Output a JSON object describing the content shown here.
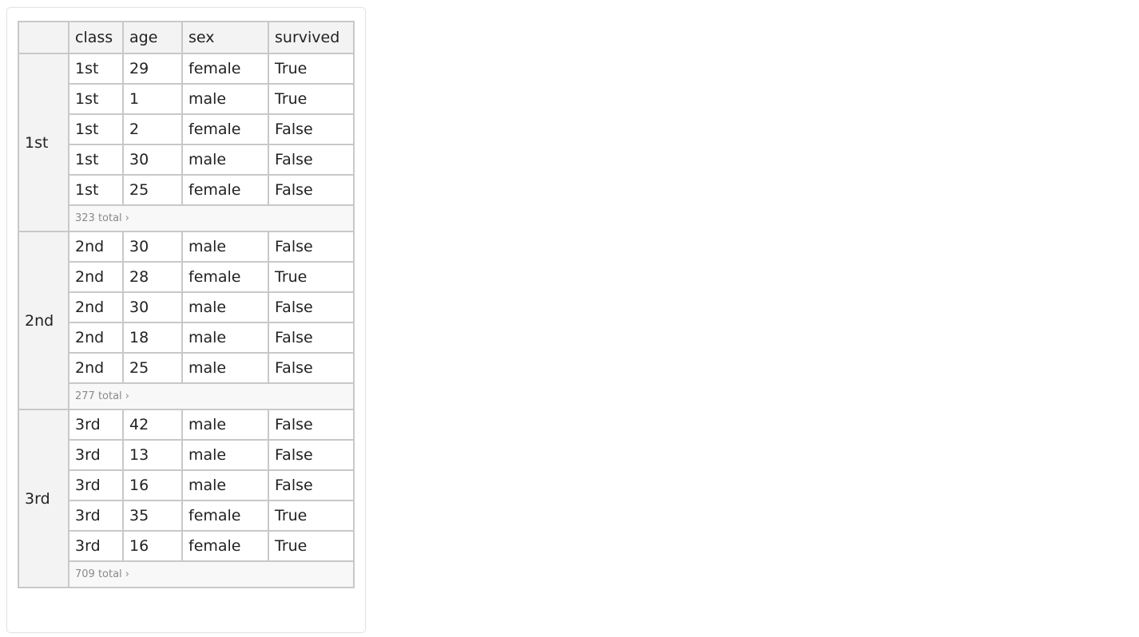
{
  "table": {
    "columns": [
      "class",
      "age",
      "sex",
      "survived"
    ],
    "groups": [
      {
        "label": "1st",
        "rows": [
          [
            "1st",
            "29",
            "female",
            "True"
          ],
          [
            "1st",
            "1",
            "male",
            "True"
          ],
          [
            "1st",
            "2",
            "female",
            "False"
          ],
          [
            "1st",
            "30",
            "male",
            "False"
          ],
          [
            "1st",
            "25",
            "female",
            "False"
          ]
        ],
        "total": "323 total ›"
      },
      {
        "label": "2nd",
        "rows": [
          [
            "2nd",
            "30",
            "male",
            "False"
          ],
          [
            "2nd",
            "28",
            "female",
            "True"
          ],
          [
            "2nd",
            "30",
            "male",
            "False"
          ],
          [
            "2nd",
            "18",
            "male",
            "False"
          ],
          [
            "2nd",
            "25",
            "male",
            "False"
          ]
        ],
        "total": "277 total ›"
      },
      {
        "label": "3rd",
        "rows": [
          [
            "3rd",
            "42",
            "male",
            "False"
          ],
          [
            "3rd",
            "13",
            "male",
            "False"
          ],
          [
            "3rd",
            "16",
            "male",
            "False"
          ],
          [
            "3rd",
            "35",
            "female",
            "True"
          ],
          [
            "3rd",
            "16",
            "female",
            "True"
          ]
        ],
        "total": "709 total ›"
      }
    ]
  }
}
